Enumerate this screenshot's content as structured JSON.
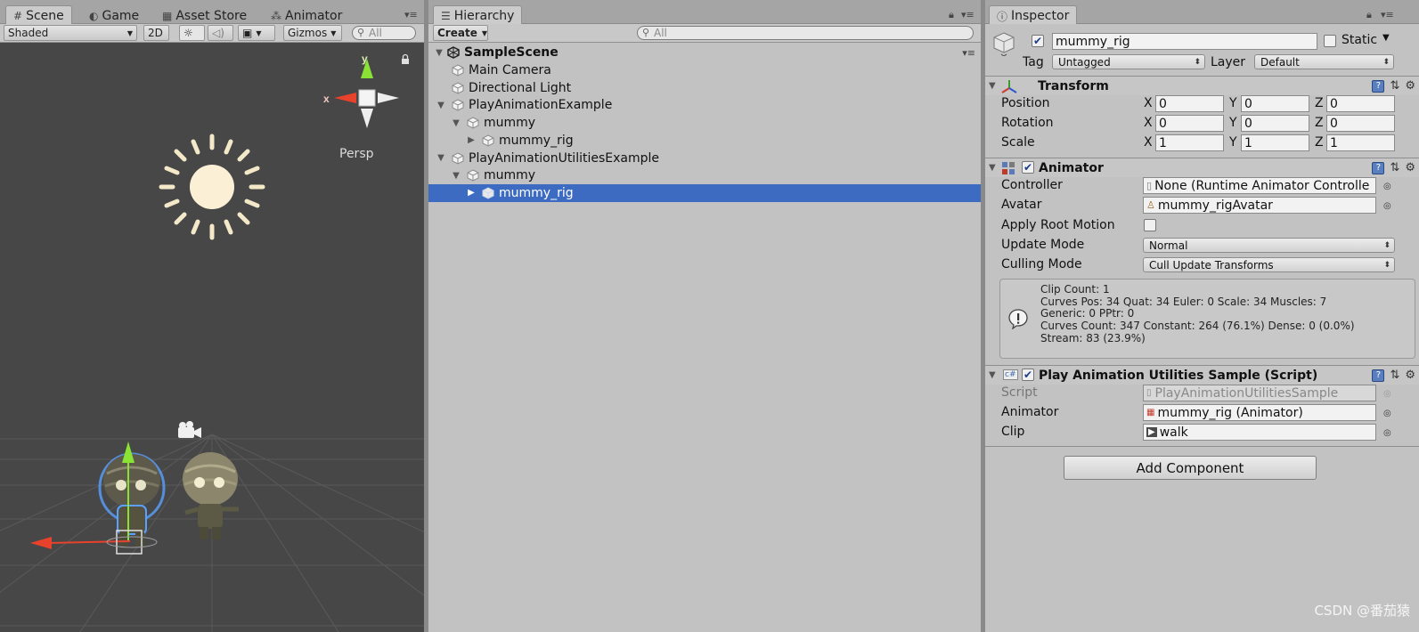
{
  "scene_panel": {
    "tabs": [
      {
        "label": "Scene",
        "icon": "grid-icon"
      },
      {
        "label": "Game",
        "icon": "pacman-icon"
      },
      {
        "label": "Asset Store",
        "icon": "store-icon"
      },
      {
        "label": "Animator",
        "icon": "animator-icon"
      }
    ],
    "toolbar": {
      "shading_mode": "Shaded",
      "mode_2d": "2D",
      "gizmos": "Gizmos",
      "search_placeholder": "All"
    },
    "gizmo_axes": {
      "y": "y",
      "x": "x"
    },
    "projection": "Persp"
  },
  "hierarchy": {
    "tab_label": "Hierarchy",
    "create_label": "Create",
    "search_placeholder": "All",
    "scene_name": "SampleScene",
    "items": [
      {
        "label": "Main Camera",
        "depth": 1,
        "arrow": "",
        "selected": false
      },
      {
        "label": "Directional Light",
        "depth": 1,
        "arrow": "",
        "selected": false
      },
      {
        "label": "PlayAnimationExample",
        "depth": 1,
        "arrow": "expanded",
        "selected": false
      },
      {
        "label": "mummy",
        "depth": 2,
        "arrow": "expanded",
        "selected": false
      },
      {
        "label": "mummy_rig",
        "depth": 3,
        "arrow": "collapsed",
        "selected": false
      },
      {
        "label": "PlayAnimationUtilitiesExample",
        "depth": 1,
        "arrow": "expanded",
        "selected": false
      },
      {
        "label": "mummy",
        "depth": 2,
        "arrow": "expanded",
        "selected": false
      },
      {
        "label": "mummy_rig",
        "depth": 3,
        "arrow": "collapsed",
        "selected": true
      }
    ]
  },
  "inspector": {
    "tab_label": "Inspector",
    "object_name": "mummy_rig",
    "static_label": "Static",
    "tag_label": "Tag",
    "tag_value": "Untagged",
    "layer_label": "Layer",
    "layer_value": "Default",
    "transform": {
      "title": "Transform",
      "rows": [
        {
          "label": "Position",
          "x": "0",
          "y": "0",
          "z": "0"
        },
        {
          "label": "Rotation",
          "x": "0",
          "y": "0",
          "z": "0"
        },
        {
          "label": "Scale",
          "x": "1",
          "y": "1",
          "z": "1"
        }
      ],
      "axis_x": "X",
      "axis_y": "Y",
      "axis_z": "Z"
    },
    "animator": {
      "title": "Animator",
      "controller_label": "Controller",
      "controller_value": "None (Runtime Animator Controlle",
      "avatar_label": "Avatar",
      "avatar_value": "mummy_rigAvatar",
      "apply_root_motion_label": "Apply Root Motion",
      "update_mode_label": "Update Mode",
      "update_mode_value": "Normal",
      "culling_mode_label": "Culling Mode",
      "culling_mode_value": "Cull Update Transforms",
      "info_lines": [
        "Clip Count: 1",
        "Curves Pos: 34 Quat: 34 Euler: 0 Scale: 34 Muscles: 7",
        "Generic: 0 PPtr: 0",
        "Curves Count: 347 Constant: 264 (76.1%) Dense: 0 (0.0%)",
        "Stream: 83 (23.9%)"
      ]
    },
    "script_component": {
      "title": "Play Animation Utilities Sample (Script)",
      "script_label": "Script",
      "script_value": "PlayAnimationUtilitiesSample",
      "animator_label": "Animator",
      "animator_value": "mummy_rig (Animator)",
      "clip_label": "Clip",
      "clip_value": "walk"
    },
    "add_component_label": "Add Component"
  },
  "watermark": "CSDN @番茄猿",
  "colors": {
    "selection": "#3d6bc2",
    "scene_bg": "#474747",
    "panel_bg": "#c2c2c2"
  }
}
